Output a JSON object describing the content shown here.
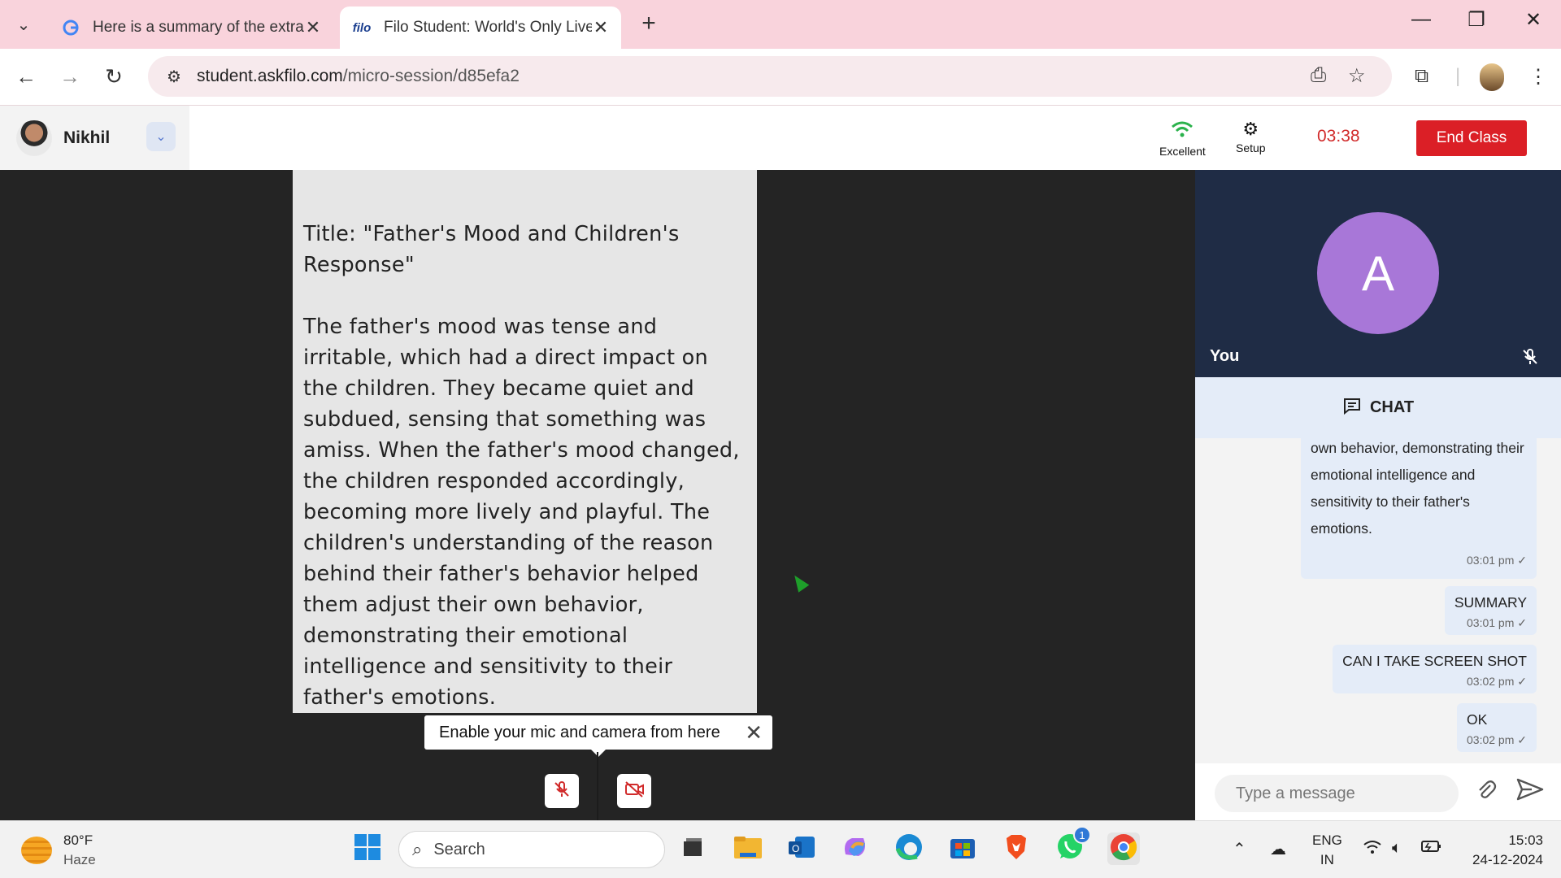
{
  "browser": {
    "tabs": [
      {
        "title": "Here is a summary of the extrac",
        "favicon": "G"
      },
      {
        "title": "Filo Student: World's Only Live I",
        "favicon": "filo"
      }
    ],
    "url_domain": "student.askfilo.com",
    "url_path": "/micro-session/d85efa2"
  },
  "header": {
    "user_name": "Nikhil",
    "network_label": "Excellent",
    "setup_label": "Setup",
    "timer": "03:38",
    "end_class_label": "End Class"
  },
  "document": {
    "title": "Title: \"Father's Mood and Children's Response\"",
    "body": "The father's mood was tense and irritable, which had a direct impact on the children. They became quiet and subdued, sensing that something was amiss. When the father's mood changed, the children responded accordingly, becoming more lively and playful. The children's understanding of the reason behind their father's behavior helped them adjust their own behavior, demonstrating their emotional intelligence and sensitivity to their father's emotions."
  },
  "tooltip": {
    "text": "Enable your mic and camera from here"
  },
  "video": {
    "avatar_letter": "A",
    "self_label": "You"
  },
  "chat": {
    "header": "CHAT",
    "messages": [
      {
        "text": "own behavior, demonstrating their emotional intelligence and sensitivity to their father's emotions.",
        "time": "03:01 pm"
      },
      {
        "text": "SUMMARY",
        "time": "03:01 pm"
      },
      {
        "text": "CAN I TAKE SCREEN SHOT",
        "time": "03:02 pm"
      },
      {
        "text": "OK",
        "time": "03:02 pm"
      }
    ],
    "placeholder": "Type a message"
  },
  "taskbar": {
    "weather_temp": "80°F",
    "weather_desc": "Haze",
    "search_label": "Search",
    "whatsapp_badge": "1",
    "lang_line1": "ENG",
    "lang_line2": "IN",
    "time": "15:03",
    "date": "24-12-2024"
  },
  "colors": {
    "tab_strip": "#f9d3dc",
    "end_class": "#db1f26",
    "timer": "#d12b2b",
    "avatar": "#a877d8",
    "video_bg": "#1f2c45",
    "chat_bubble": "#e4ecf8"
  }
}
